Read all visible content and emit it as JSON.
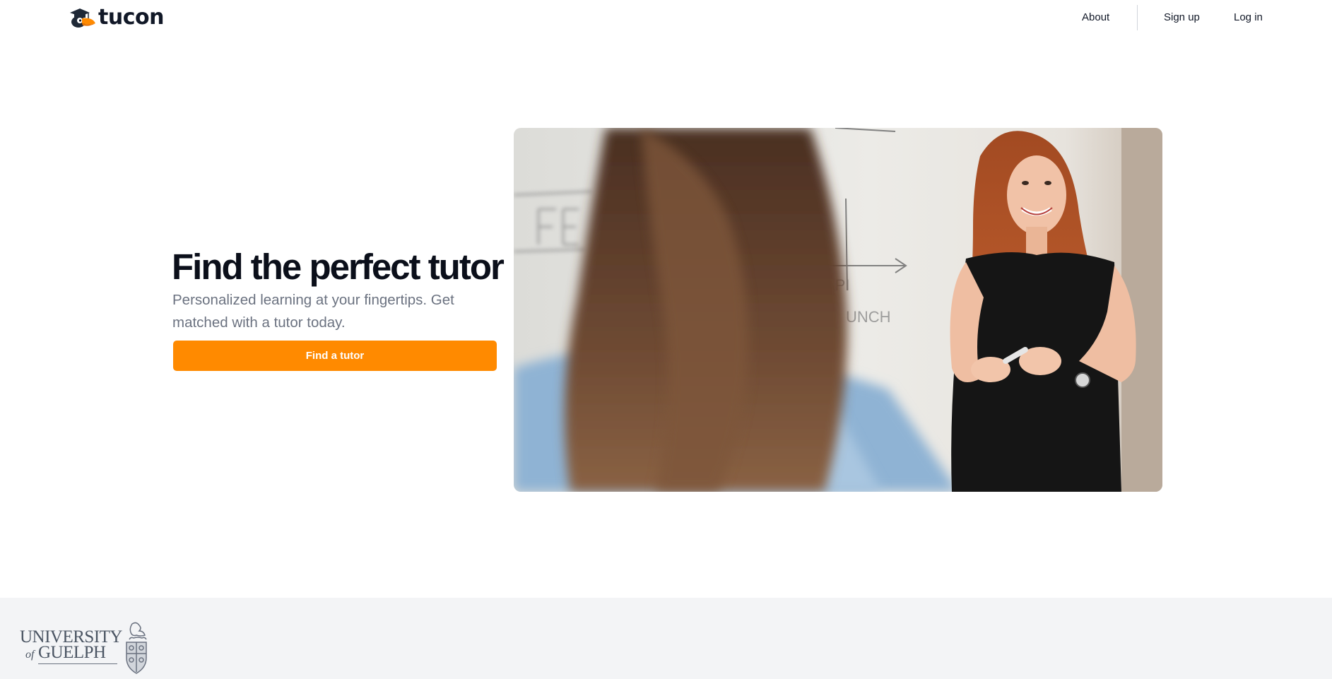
{
  "header": {
    "logo_text": "tucon",
    "nav": {
      "about": "About",
      "signup": "Sign up",
      "login": "Log in"
    }
  },
  "hero": {
    "title": "Find the perfect tutor",
    "subtitle": "Personalized learning at your fingertips. Get matched with a tutor today.",
    "cta_label": "Find a tutor",
    "image_alt": ""
  },
  "footer": {
    "logo_line1": "UNIVERSITY",
    "logo_of": "of",
    "logo_line2": "GUELPH"
  },
  "colors": {
    "accent": "#ff8a00",
    "text_primary": "#0b0f1a",
    "text_secondary": "#6b7280",
    "footer_bg": "#f3f4f6"
  },
  "icons": {
    "logo_mark": "toucan-graduation-cap-icon",
    "footer_crest": "university-crest-icon"
  }
}
